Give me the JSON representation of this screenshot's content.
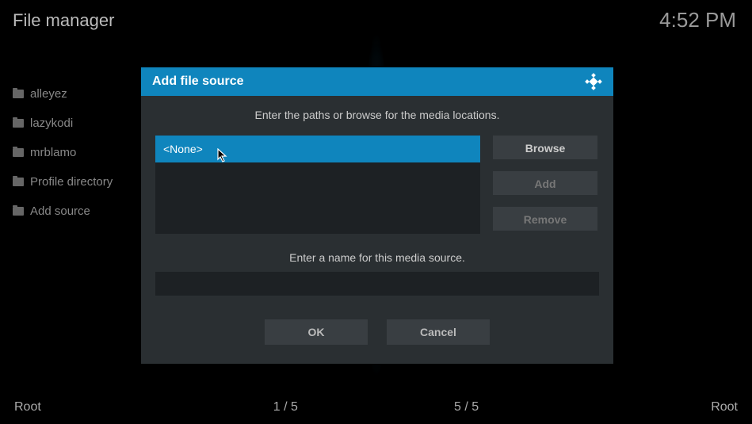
{
  "header": {
    "title": "File manager",
    "clock": "4:52 PM"
  },
  "sidebar": {
    "items": [
      {
        "label": "alleyez"
      },
      {
        "label": "lazykodi"
      },
      {
        "label": "mrblamo"
      },
      {
        "label": "Profile directory"
      },
      {
        "label": "Add source"
      }
    ]
  },
  "footer": {
    "left_label": "Root",
    "left_counter": "1 / 5",
    "right_counter": "5 / 5",
    "right_label": "Root"
  },
  "dialog": {
    "title": "Add file source",
    "instruction": "Enter the paths or browse for the media locations.",
    "path_item": "<None>",
    "browse_label": "Browse",
    "add_label": "Add",
    "remove_label": "Remove",
    "name_label": "Enter a name for this media source.",
    "name_value": "",
    "ok_label": "OK",
    "cancel_label": "Cancel"
  }
}
